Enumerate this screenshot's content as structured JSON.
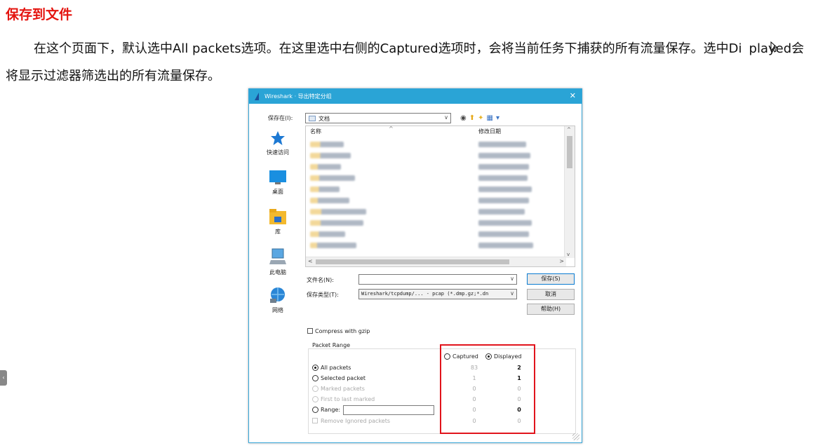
{
  "article": {
    "heading": "保存到文件",
    "paragraph_part1": "在这个页面下，默认选中All packets选项。在这里选中右侧的Captured选项时，会将当前任务下捕获的所有流量保存。选中Di",
    "paragraph_part2": "played会将显示过滤器筛选出的所有流量保存。"
  },
  "colors": {
    "heading": "#e4140f",
    "titlebar": "#2aa4d6",
    "highlight_box": "#e1141c"
  },
  "dialog": {
    "title": "Wireshark · 导出特定分组",
    "close_label": "✕",
    "save_in_label": "保存在(I):",
    "save_in_value": "文档",
    "toolbar_icons": [
      "back-icon",
      "up-folder-icon",
      "new-folder-icon",
      "view-menu-icon"
    ],
    "places": [
      {
        "label": "快速访问",
        "icon": "star-icon"
      },
      {
        "label": "桌面",
        "icon": "desktop-icon"
      },
      {
        "label": "库",
        "icon": "library-icon"
      },
      {
        "label": "此电脑",
        "icon": "computer-icon"
      },
      {
        "label": "网络",
        "icon": "network-icon"
      }
    ],
    "file_list": {
      "col_name": "名称",
      "col_date": "修改日期",
      "sort_glyph": "^"
    },
    "filename_label": "文件名(N):",
    "filename_value": "",
    "filetype_label": "保存类型(T):",
    "filetype_value": "Wireshark/tcpdump/... - pcap (*.dmp.gz;*.dn",
    "buttons": {
      "save": "保存(S)",
      "cancel": "取消",
      "help": "帮助(H)"
    },
    "compress_label": "Compress with gzip",
    "packet_range": {
      "title": "Packet Range",
      "captured_label": "Captured",
      "displayed_label": "Displayed",
      "selected_column": "Displayed",
      "rows": [
        {
          "label": "All packets",
          "enabled": true,
          "selected": true,
          "captured": "83",
          "displayed": "2"
        },
        {
          "label": "Selected packet",
          "enabled": true,
          "selected": false,
          "captured": "1",
          "displayed": "1"
        },
        {
          "label": "Marked packets",
          "enabled": false,
          "selected": false,
          "captured": "0",
          "displayed": "0"
        },
        {
          "label": "First to last marked",
          "enabled": false,
          "selected": false,
          "captured": "0",
          "displayed": "0"
        },
        {
          "label": "Range:",
          "enabled": true,
          "selected": false,
          "captured": "0",
          "displayed": "0"
        },
        {
          "label": "Remove Ignored packets",
          "enabled": false,
          "selected": false,
          "captured": "0",
          "displayed": "0"
        }
      ]
    }
  }
}
